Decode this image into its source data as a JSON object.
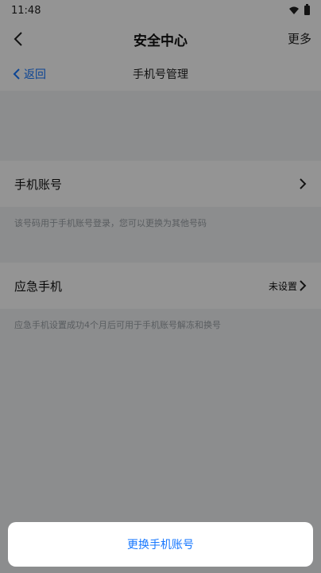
{
  "status_bar": {
    "time": "11:48",
    "icons": [
      "wifi-icon",
      "battery-icon"
    ]
  },
  "app_bar": {
    "title": "安全中心",
    "more_label": "更多",
    "back_icon": "chevron-left-icon"
  },
  "sub_header": {
    "back_label": "返回",
    "title": "手机号管理",
    "back_icon": "chevron-left-icon"
  },
  "rows": {
    "phone": {
      "label": "手机账号",
      "value": "",
      "chevron_icon": "chevron-right-icon"
    },
    "phone_hint": "该号码用于手机账号登录，您可以更换为其他号码",
    "emergency": {
      "label": "应急手机",
      "value": "未设置",
      "chevron_icon": "chevron-right-icon"
    },
    "emergency_hint": "应急手机设置成功4个月后可用于手机账号解冻和换号"
  },
  "bottom_sheet": {
    "action_label": "更换手机账号"
  },
  "colors": {
    "accent": "#1677ff",
    "overlay": "rgba(0,0,0,0.42)",
    "page_bg": "#f2f3f5"
  }
}
